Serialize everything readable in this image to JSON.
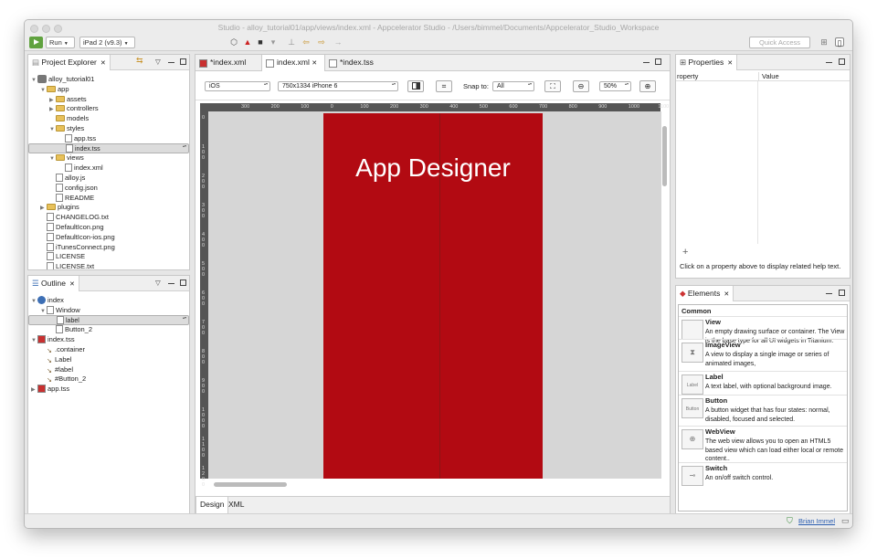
{
  "window": {
    "title": "Studio - alloy_tutorial01/app/views/index.xml - Appcelerator Studio - /Users/bimmel/Documents/Appcelerator_Studio_Workspace"
  },
  "toolbar": {
    "run_label": "Run",
    "target_label": "iPad 2 (v9.3)",
    "quick_access": "Quick Access"
  },
  "project_explorer": {
    "title": "Project Explorer",
    "items": [
      {
        "label": "alloy_tutorial01",
        "type": "project",
        "depth": 0,
        "arrow": "down"
      },
      {
        "label": "app",
        "type": "folder",
        "depth": 1,
        "arrow": "down"
      },
      {
        "label": "assets",
        "type": "folder",
        "depth": 2,
        "arrow": "right"
      },
      {
        "label": "controllers",
        "type": "folder",
        "depth": 2,
        "arrow": "right"
      },
      {
        "label": "models",
        "type": "folder",
        "depth": 2,
        "arrow": ""
      },
      {
        "label": "styles",
        "type": "folder",
        "depth": 2,
        "arrow": "down"
      },
      {
        "label": "app.tss",
        "type": "file",
        "depth": 3,
        "arrow": ""
      },
      {
        "label": "index.tss",
        "type": "file",
        "depth": 3,
        "arrow": "",
        "selected": true
      },
      {
        "label": "views",
        "type": "folder",
        "depth": 2,
        "arrow": "down"
      },
      {
        "label": "index.xml",
        "type": "file",
        "depth": 3,
        "arrow": ""
      },
      {
        "label": "alloy.js",
        "type": "file",
        "depth": 2,
        "arrow": ""
      },
      {
        "label": "config.json",
        "type": "file",
        "depth": 2,
        "arrow": ""
      },
      {
        "label": "README",
        "type": "file",
        "depth": 2,
        "arrow": ""
      },
      {
        "label": "plugins",
        "type": "folder",
        "depth": 1,
        "arrow": "right"
      },
      {
        "label": "CHANGELOG.txt",
        "type": "file",
        "depth": 1,
        "arrow": ""
      },
      {
        "label": "DefaultIcon.png",
        "type": "file",
        "depth": 1,
        "arrow": ""
      },
      {
        "label": "DefaultIcon-ios.png",
        "type": "file",
        "depth": 1,
        "arrow": ""
      },
      {
        "label": "iTunesConnect.png",
        "type": "file",
        "depth": 1,
        "arrow": ""
      },
      {
        "label": "LICENSE",
        "type": "file",
        "depth": 1,
        "arrow": ""
      },
      {
        "label": "LICENSE.txt",
        "type": "file",
        "depth": 1,
        "arrow": ""
      }
    ]
  },
  "outline": {
    "title": "Outline",
    "items": [
      {
        "label": "index",
        "type": "win",
        "depth": 0,
        "arrow": "down"
      },
      {
        "label": "Window",
        "type": "node",
        "depth": 1,
        "arrow": "down"
      },
      {
        "label": "label",
        "type": "node",
        "depth": 2,
        "arrow": "",
        "selected": true
      },
      {
        "label": "Button_2",
        "type": "node",
        "depth": 2,
        "arrow": ""
      },
      {
        "label": "index.tss",
        "type": "tss",
        "depth": 0,
        "arrow": "down"
      },
      {
        "label": ".container",
        "type": "rule",
        "depth": 1,
        "arrow": ""
      },
      {
        "label": "Label",
        "type": "rule",
        "depth": 1,
        "arrow": ""
      },
      {
        "label": "#label",
        "type": "rule",
        "depth": 1,
        "arrow": ""
      },
      {
        "label": "#Button_2",
        "type": "rule",
        "depth": 1,
        "arrow": ""
      },
      {
        "label": "app.tss",
        "type": "tss",
        "depth": 0,
        "arrow": "right"
      }
    ]
  },
  "editor": {
    "tabs": [
      {
        "label": "*index.xml",
        "active": false
      },
      {
        "label": "index.xml",
        "active": true
      },
      {
        "label": "*index.tss",
        "active": false
      }
    ],
    "platform": "iOS",
    "device": "750x1334 iPhone 6",
    "snap_label": "Snap to:",
    "snap_value": "All",
    "zoom": "50%",
    "ruler_top": [
      "300",
      "200",
      "100",
      "0",
      "100",
      "200",
      "300",
      "400",
      "500",
      "600",
      "700",
      "800",
      "900",
      "1000",
      "1100"
    ],
    "ruler_left": [
      "0",
      "100",
      "200",
      "300",
      "400",
      "500",
      "600",
      "700",
      "800",
      "900",
      "1000",
      "1100",
      "1200"
    ],
    "canvas_label": "App Designer",
    "bottom_tabs": [
      "Design",
      "XML"
    ]
  },
  "properties": {
    "title": "Properties",
    "col_property": "roperty",
    "col_value": "Value",
    "add": "+",
    "help": "Click on a property above to display related help text."
  },
  "elements": {
    "title": "Elements",
    "section": "Common",
    "items": [
      {
        "title": "View",
        "desc": "An empty drawing surface or container. The View is the base type for all UI widgets in Titanium."
      },
      {
        "title": "ImageView",
        "desc": "A view to display a single image or series of animated images,"
      },
      {
        "title": "Label",
        "desc": "A text label, with optional background image.",
        "icon_text": "Label"
      },
      {
        "title": "Button",
        "desc": "A button widget that has four states: normal, disabled, focused and selected.",
        "icon_text": "Button"
      },
      {
        "title": "WebView",
        "desc": "The web view allows you to open an HTML5 based view which can load either local or remote content.."
      },
      {
        "title": "Switch",
        "desc": "An on/off switch control."
      }
    ]
  },
  "status": {
    "user": "Brian Immel"
  },
  "colors": {
    "device_red": "#b20a12",
    "run_green": "#60a23f"
  }
}
